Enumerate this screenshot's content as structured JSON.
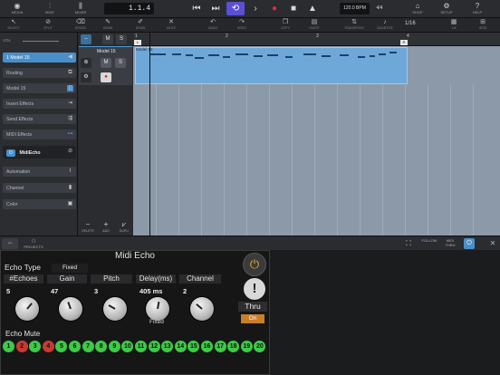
{
  "toolbar": {
    "buttons": [
      {
        "icon": "mixer-icon",
        "label": "MEDIA"
      },
      {
        "icon": "mixer-sliders-icon",
        "label": "MIXE"
      },
      {
        "icon": "mixer-faders-icon",
        "label": "MIXER"
      }
    ],
    "position": "1.1.4",
    "tempo": "120.0 BPM",
    "time_signature": "4/4",
    "right_buttons": [
      {
        "icon": "shop-icon",
        "label": "SHOP"
      },
      {
        "icon": "setup-icon",
        "label": "SETUP"
      },
      {
        "icon": "help-icon",
        "label": "HELP"
      }
    ],
    "quantize_value": "1/16"
  },
  "toolbar2": {
    "tools": [
      "SELECT",
      "SPLIT",
      "ERASE",
      "DRAW",
      "MUTE",
      "UNDO",
      "REDO",
      "COPY",
      "PASTE",
      "TRANSPOSE",
      "QUANTIZE",
      "GRID"
    ],
    "grid_label": "1/8"
  },
  "inspector": {
    "volume_label": "VOL",
    "track_name": "1  Model 15",
    "rows": [
      {
        "label": "Routing"
      },
      {
        "label": "Model 15"
      },
      {
        "label": "Insert Effects"
      },
      {
        "label": "Send Effects"
      },
      {
        "label": "MIDI Effects"
      }
    ],
    "midi_effect_slot": "MidiEcho",
    "rows2": [
      {
        "label": "Automation"
      },
      {
        "label": "Channel"
      },
      {
        "label": "Color"
      }
    ],
    "bottom_buttons": [
      "DELETE",
      "ADD",
      "DUPLI"
    ]
  },
  "track": {
    "name": "Model 15",
    "mute_label": "M",
    "solo_label": "S"
  },
  "ruler": {
    "bars": [
      "1",
      "2",
      "3",
      "4"
    ]
  },
  "clip": {
    "name": "Model 15"
  },
  "editor_bar": {
    "left_label": "PROJECTS",
    "right_buttons": [
      "FOLLOW",
      "MIDI THRU"
    ]
  },
  "echo": {
    "title": "Midi Echo",
    "echo_type_label": "Echo Type",
    "echo_type_value": "Fixed",
    "columns": [
      {
        "header": "#Echoes",
        "value": "5"
      },
      {
        "header": "Gain",
        "value": "47"
      },
      {
        "header": "Pitch",
        "value": "3"
      },
      {
        "header": "Delay(ms)",
        "value": "405 ms",
        "sub": "Fixed"
      },
      {
        "header": "Channel",
        "value": "2"
      }
    ],
    "thru_label": "Thru",
    "thru_value": "On",
    "mute_label": "Echo Mute",
    "mute_buttons": [
      {
        "n": "1",
        "on": true
      },
      {
        "n": "2",
        "on": false
      },
      {
        "n": "3",
        "on": true
      },
      {
        "n": "4",
        "on": false
      },
      {
        "n": "5",
        "on": true
      },
      {
        "n": "6",
        "on": true
      },
      {
        "n": "7",
        "on": true
      },
      {
        "n": "8",
        "on": true
      },
      {
        "n": "9",
        "on": true
      },
      {
        "n": "10",
        "on": true
      },
      {
        "n": "11",
        "on": true
      },
      {
        "n": "12",
        "on": true
      },
      {
        "n": "13",
        "on": true
      },
      {
        "n": "14",
        "on": true
      },
      {
        "n": "15",
        "on": true
      },
      {
        "n": "16",
        "on": true
      },
      {
        "n": "17",
        "on": true
      },
      {
        "n": "18",
        "on": true
      },
      {
        "n": "19",
        "on": true
      },
      {
        "n": "20",
        "on": true
      }
    ]
  },
  "colors": {
    "accent": "#5b4fd6",
    "track_blue": "#4b8fc9",
    "clip": "#6ea8d8",
    "mute_on": "#3fc948",
    "mute_off": "#c83a34",
    "power": "#f0b020"
  }
}
